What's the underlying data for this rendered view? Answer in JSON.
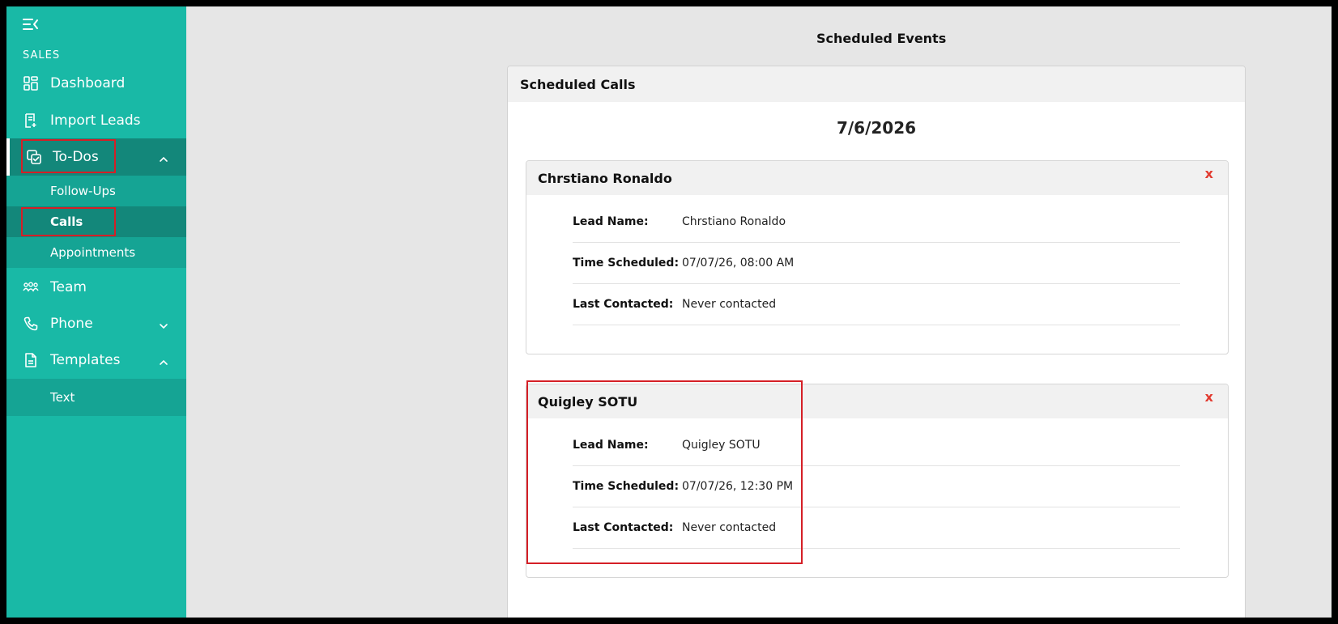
{
  "sidebar": {
    "section_label": "SALES",
    "items": [
      {
        "label": "Dashboard",
        "icon": "dashboard-icon"
      },
      {
        "label": "Import Leads",
        "icon": "import-leads-icon"
      },
      {
        "label": "To-Dos",
        "icon": "todos-icon"
      },
      {
        "label": "Team",
        "icon": "team-icon"
      },
      {
        "label": "Phone",
        "icon": "phone-icon"
      },
      {
        "label": "Templates",
        "icon": "templates-icon"
      }
    ],
    "todos_sub": [
      "Follow-Ups",
      "Calls",
      "Appointments"
    ],
    "templates_sub": [
      "Text"
    ],
    "colors": {
      "bg": "#19b9a6",
      "active": "#13877a",
      "submenu": "#15a494"
    }
  },
  "main": {
    "page_title": "Scheduled Events",
    "panel_title": "Scheduled Calls",
    "date": "7/6/2026",
    "remove_label": "x",
    "events": [
      {
        "name": "Chrstiano Ronaldo",
        "lead_name_label": "Lead Name:",
        "lead_name": "Chrstiano Ronaldo",
        "time_label": "Time Scheduled:",
        "time": "07/07/26, 08:00 AM",
        "contact_label": "Last Contacted:",
        "contact": "Never contacted"
      },
      {
        "name": "Quigley SOTU",
        "lead_name_label": "Lead Name:",
        "lead_name": "Quigley SOTU",
        "time_label": "Time Scheduled:",
        "time": "07/07/26, 12:30 PM",
        "contact_label": "Last Contacted:",
        "contact": "Never contacted"
      }
    ]
  },
  "annotation_color": "#d51f26"
}
